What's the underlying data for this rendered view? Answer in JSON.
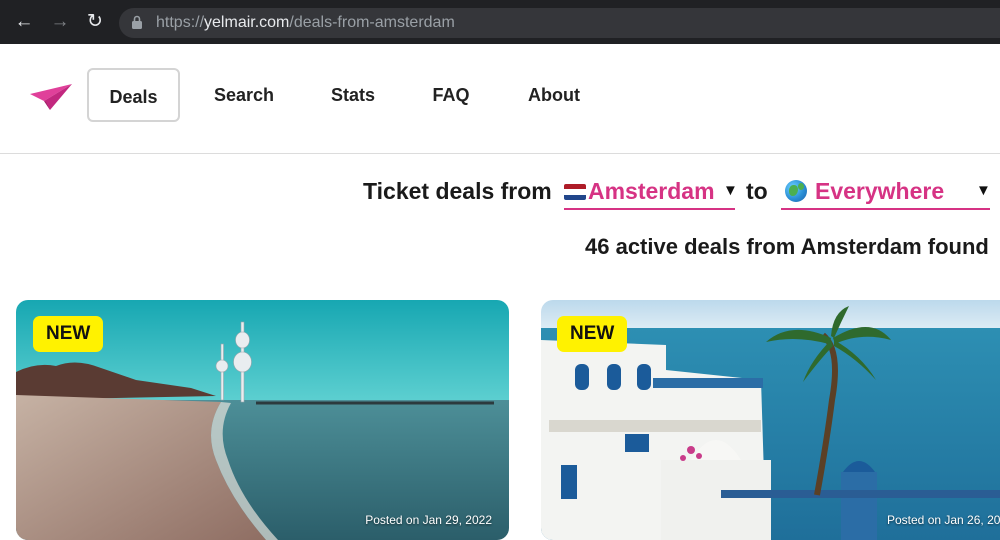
{
  "browser": {
    "url_scheme": "https://",
    "url_host": "yelmair.com",
    "url_path": "/deals-from-amsterdam"
  },
  "nav": {
    "items": [
      {
        "label": "Deals",
        "active": true
      },
      {
        "label": "Search"
      },
      {
        "label": "Stats"
      },
      {
        "label": "FAQ"
      },
      {
        "label": "About"
      }
    ]
  },
  "filter": {
    "prefix": "Ticket deals from",
    "from_value": "Amsterdam",
    "connector": "to",
    "to_value": "Everywhere"
  },
  "results": {
    "summary": "46 active deals from Amsterdam found"
  },
  "deals": [
    {
      "badge": "NEW",
      "posted": "Posted on Jan 29, 2022"
    },
    {
      "badge": "NEW",
      "posted": "Posted on Jan 26, 20"
    }
  ],
  "colors": {
    "accent": "#d63384",
    "badge": "#fff200",
    "chrome": "#202124"
  }
}
